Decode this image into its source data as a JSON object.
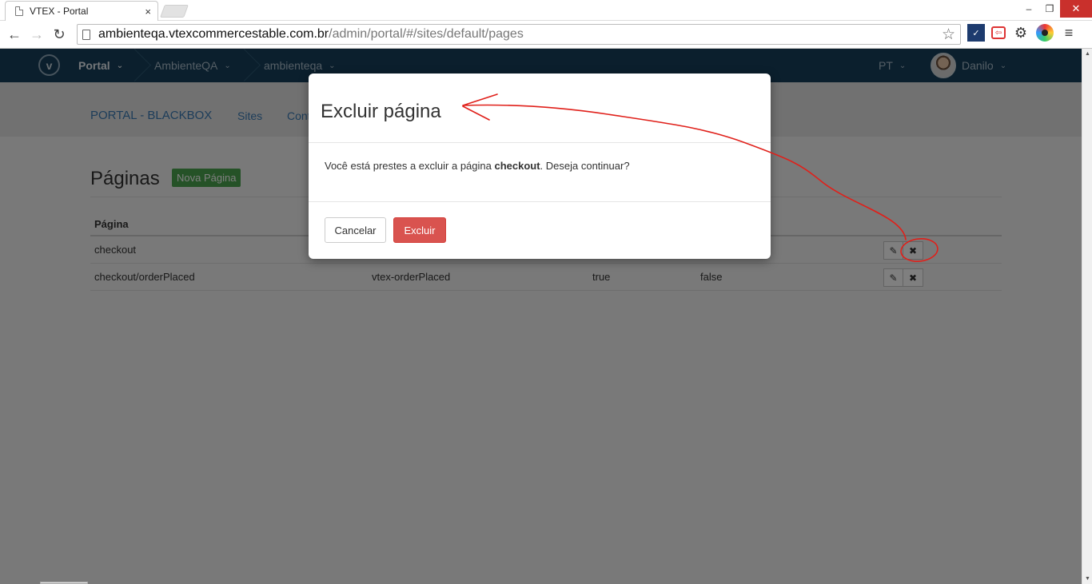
{
  "browser": {
    "tab_title": "VTEX - Portal",
    "tab_close": "×",
    "url_host": "ambienteqa.vtexcommercestable.com.br",
    "url_path": "/admin/portal/#/sites/default/pages",
    "window_controls": {
      "minimize": "–",
      "restore": "❐",
      "close": "✕"
    },
    "nav": {
      "back": "←",
      "forward": "→",
      "reload": "↻"
    },
    "star": "☆",
    "menu": "≡"
  },
  "appbar": {
    "logo": "v",
    "crumbs": [
      {
        "label": "Portal"
      },
      {
        "label": "AmbienteQA"
      },
      {
        "label": "ambienteqa"
      }
    ],
    "chevron": "⌄",
    "language": "PT",
    "user": "Danilo"
  },
  "subnav": {
    "title": "PORTAL - BLACKBOX",
    "links": [
      "Sites",
      "Cont"
    ]
  },
  "page": {
    "heading": "Páginas",
    "new_button": "Nova Página",
    "table": {
      "column_header": "Página",
      "rows": [
        {
          "page": "checkout",
          "template": "",
          "col3": "",
          "col4": ""
        },
        {
          "page": "checkout/orderPlaced",
          "template": "vtex-orderPlaced",
          "col3": "true",
          "col4": "false"
        }
      ],
      "edit_icon": "✎",
      "delete_icon": "✖"
    }
  },
  "modal": {
    "title": "Excluir página",
    "body_prefix": "Você está prestes a excluir a página ",
    "body_bold": "checkout",
    "body_suffix": ". Deseja continuar?",
    "cancel_label": "Cancelar",
    "delete_label": "Excluir"
  },
  "colors": {
    "appbar": "#173f5a",
    "link": "#3a7ab5",
    "success": "#4aa54e",
    "danger": "#d9534f",
    "annotation": "#e0201a"
  }
}
